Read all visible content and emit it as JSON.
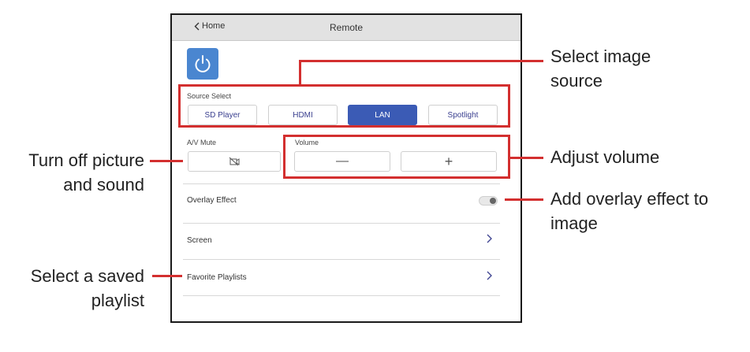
{
  "app": {
    "title": "Remote",
    "back_label": "Home"
  },
  "source_select": {
    "label": "Source Select",
    "options": [
      "SD Player",
      "HDMI",
      "LAN",
      "Spotlight"
    ],
    "selected": "LAN"
  },
  "av_mute": {
    "label": "A/V Mute",
    "icon": "av-mute-icon"
  },
  "volume": {
    "label": "Volume",
    "minus": "—",
    "plus": "+"
  },
  "overlay": {
    "label": "Overlay Effect",
    "enabled": false
  },
  "rows": [
    {
      "label": "Screen"
    },
    {
      "label": "Favorite Playlists"
    }
  ],
  "callouts": {
    "source": [
      "Select image",
      "source"
    ],
    "mute": [
      "Turn off picture",
      "and sound"
    ],
    "volume": [
      "Adjust volume"
    ],
    "overlay": [
      "Add overlay effect to",
      "image"
    ],
    "playlist": [
      "Select a saved",
      "playlist"
    ]
  },
  "colors": {
    "accent": "#3b5bb5",
    "power": "#4a86d0",
    "callout": "#d32f2f"
  }
}
